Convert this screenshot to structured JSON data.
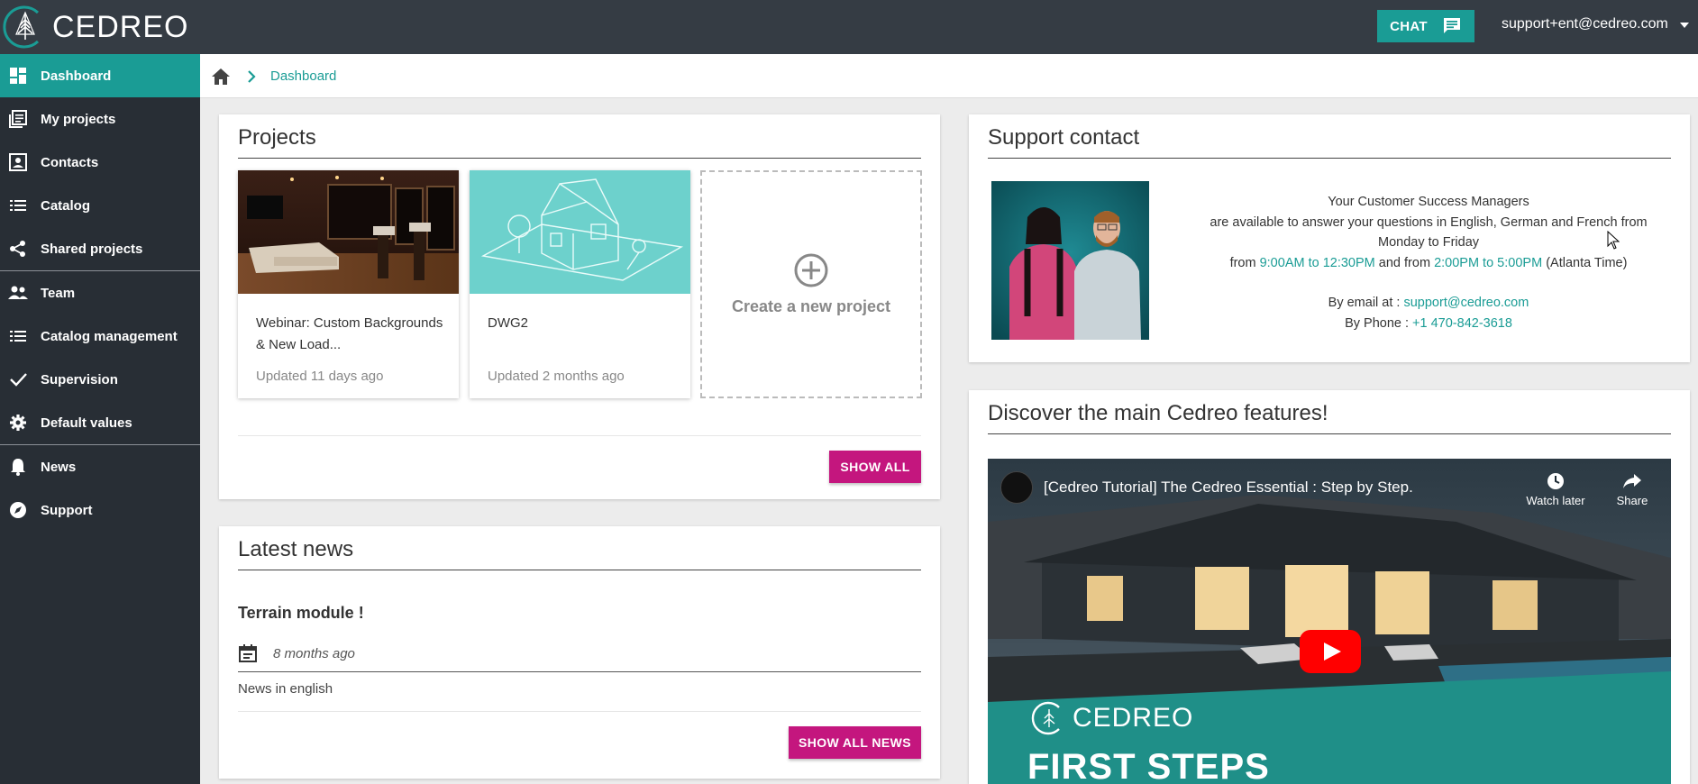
{
  "app": {
    "brand": "CEDREO"
  },
  "topbar": {
    "chat_label": "CHAT",
    "user_email": "support+ent@cedreo.com"
  },
  "sidebar": {
    "items": [
      {
        "label": "Dashboard",
        "icon": "dashboard-icon",
        "active": true
      },
      {
        "label": "My projects",
        "icon": "projects-icon"
      },
      {
        "label": "Contacts",
        "icon": "contacts-icon"
      },
      {
        "label": "Catalog",
        "icon": "list-icon"
      },
      {
        "label": "Shared projects",
        "icon": "share-icon"
      },
      {
        "label": "Team",
        "icon": "team-icon"
      },
      {
        "label": "Catalog management",
        "icon": "list-icon"
      },
      {
        "label": "Supervision",
        "icon": "check-icon"
      },
      {
        "label": "Default values",
        "icon": "gear-icon"
      },
      {
        "label": "News",
        "icon": "bell-icon"
      },
      {
        "label": "Support",
        "icon": "compass-icon"
      }
    ]
  },
  "breadcrumb": {
    "current": "Dashboard"
  },
  "projects": {
    "title": "Projects",
    "items": [
      {
        "name": "Webinar: Custom Backgrounds & New Load...",
        "updated": "Updated 11 days ago"
      },
      {
        "name": "DWG2",
        "updated": "Updated 2 months ago"
      }
    ],
    "create_label": "Create a new project",
    "show_all_label": "SHOW ALL"
  },
  "news": {
    "title": "Latest news",
    "item_title": "Terrain module !",
    "item_date": "8 months ago",
    "item_body": "News in english",
    "show_all_label": "SHOW ALL NEWS"
  },
  "support": {
    "title": "Support contact",
    "line1": "Your Customer Success Managers",
    "line2": "are available to answer your questions in English, German and French from Monday to Friday",
    "from_label": "from",
    "hours1": "9:00AM to 12:30PM",
    "and_from_label": "and from",
    "hours2": "2:00PM to 5:00PM",
    "tz": "(Atlanta Time)",
    "email_label": "By email at :",
    "email": "support@cedreo.com",
    "phone_label": "By Phone :",
    "phone": "+1 470-842-3618"
  },
  "features": {
    "title": "Discover the main Cedreo features!",
    "video_title": "[Cedreo Tutorial] The Cedreo Essential : Step by Step.",
    "watch_later": "Watch later",
    "share": "Share",
    "video_brand": "CEDREO",
    "video_steps": "FIRST STEPS"
  },
  "colors": {
    "teal": "#1a9c95",
    "pink": "#c4167e",
    "topbar": "#353c44",
    "sidebar": "#282e35"
  }
}
